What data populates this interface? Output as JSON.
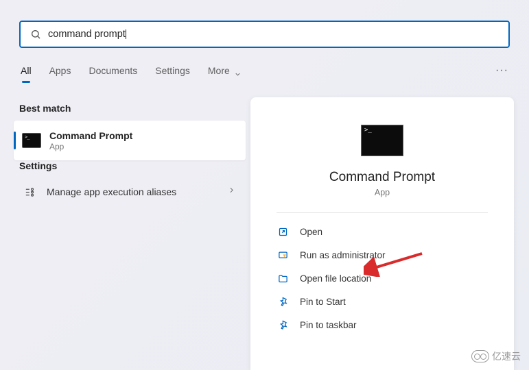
{
  "search": {
    "value": "command prompt"
  },
  "tabs": {
    "items": [
      "All",
      "Apps",
      "Documents",
      "Settings",
      "More"
    ],
    "active_index": 0
  },
  "sections": {
    "best_match": "Best match",
    "settings": "Settings"
  },
  "best_match": {
    "title": "Command Prompt",
    "subtitle": "App"
  },
  "settings_items": [
    {
      "label": "Manage app execution aliases",
      "icon": "aliases-icon"
    }
  ],
  "panel": {
    "title": "Command Prompt",
    "subtitle": "App",
    "actions": [
      {
        "icon": "open-icon",
        "label": "Open"
      },
      {
        "icon": "admin-icon",
        "label": "Run as administrator"
      },
      {
        "icon": "folder-icon",
        "label": "Open file location"
      },
      {
        "icon": "pin-icon",
        "label": "Pin to Start"
      },
      {
        "icon": "pin-icon",
        "label": "Pin to taskbar"
      }
    ]
  },
  "accent_color": "#0067C0",
  "watermark": "亿速云"
}
